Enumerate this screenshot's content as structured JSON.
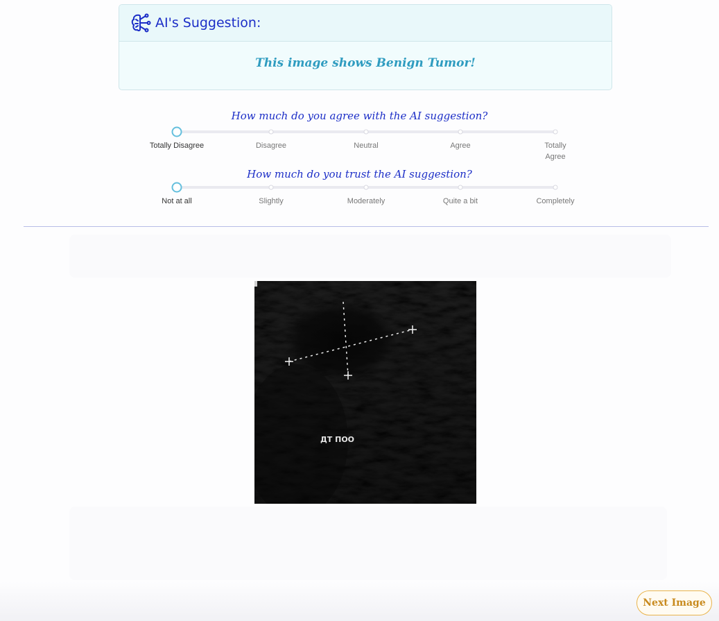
{
  "suggestion": {
    "title": "AI's Suggestion:",
    "result": "This image shows Benign Tumor!",
    "icon": "brain-circuit-icon"
  },
  "agreement": {
    "question": "How much do you agree with the AI suggestion?",
    "options": [
      "Totally Disagree",
      "Disagree",
      "Neutral",
      "Agree",
      "Totally Agree"
    ],
    "selected_index": 0
  },
  "trust": {
    "question": "How much do you trust the AI suggestion?",
    "options": [
      "Not at all",
      "Slightly",
      "Moderately",
      "Quite a bit",
      "Completely"
    ],
    "selected_index": 0
  },
  "image": {
    "overlay_text": "ДТ ПОО"
  },
  "footer": {
    "next_label": "Next Image"
  },
  "colors": {
    "accent_blue": "#1c2ec7",
    "result_teal": "#2f9cc0",
    "slider_handle": "#64bfdd",
    "next_button": "#c88a1e"
  }
}
